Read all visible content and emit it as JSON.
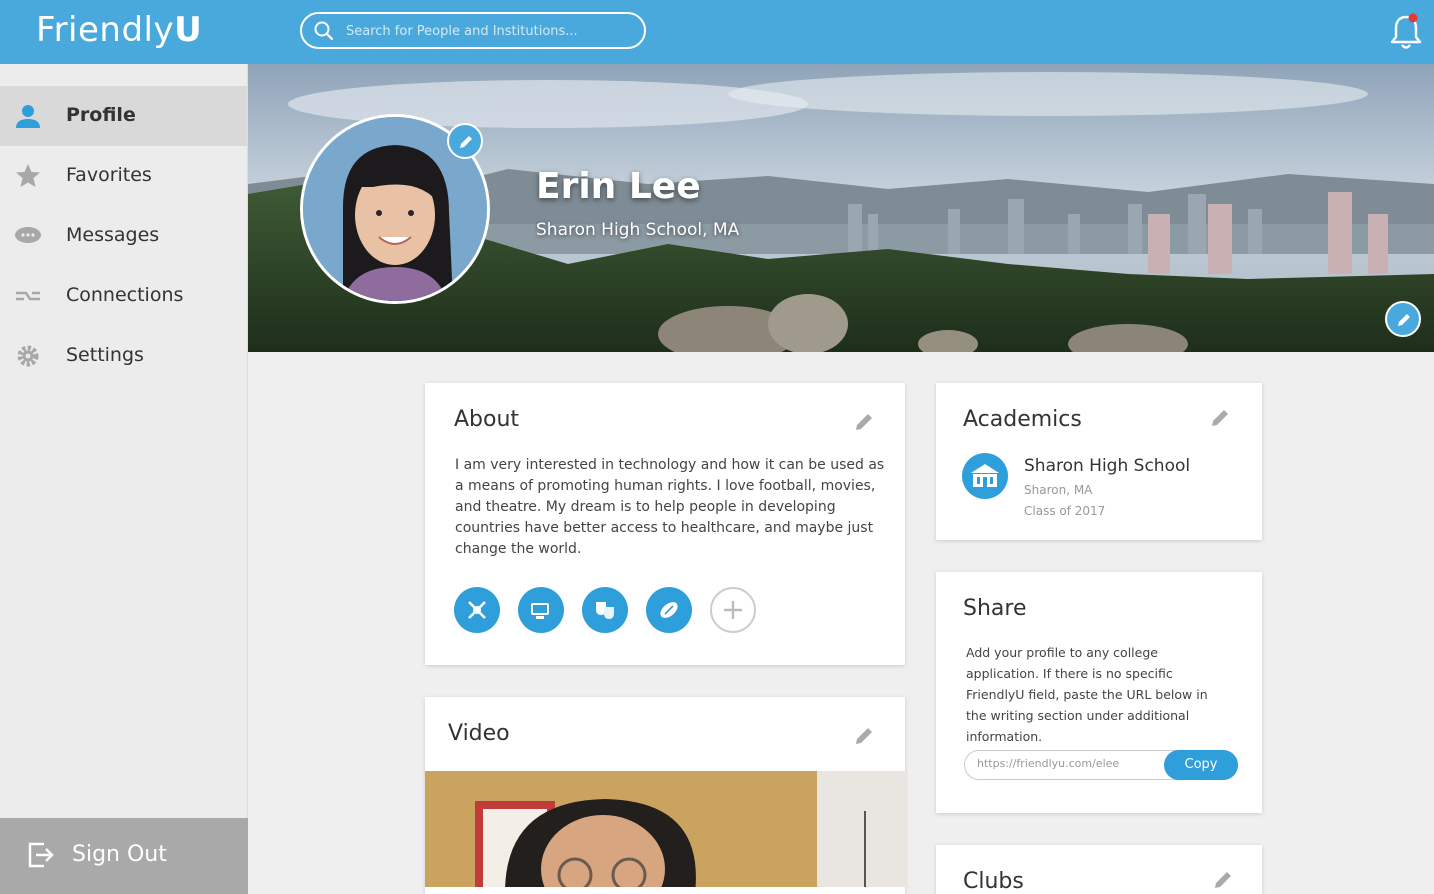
{
  "app": {
    "logo_main": "Friendly",
    "logo_bold": "U"
  },
  "search": {
    "placeholder": "Search for People and Institutions..."
  },
  "sidebar": {
    "items": [
      {
        "label": "Profile",
        "icon": "person-icon",
        "active": true
      },
      {
        "label": "Favorites",
        "icon": "star-icon"
      },
      {
        "label": "Messages",
        "icon": "chat-icon"
      },
      {
        "label": "Connections",
        "icon": "connections-icon"
      },
      {
        "label": "Settings",
        "icon": "gear-icon"
      }
    ],
    "signout_label": "Sign Out"
  },
  "profile": {
    "name": "Erin Lee",
    "school": "Sharon High School, MA"
  },
  "about": {
    "title": "About",
    "text": "I am very interested in technology and how it can be used as a means of promoting human rights. I love football, movies, and theatre. My dream is to help people in developing countries have better access to healthcare, and maybe just change the world.",
    "interests": [
      "technology-icon",
      "movies-icon",
      "theatre-icon",
      "football-icon"
    ]
  },
  "academics": {
    "title": "Academics",
    "school_name": "Sharon High School",
    "location": "Sharon, MA",
    "class": "Class of 2017"
  },
  "share": {
    "title": "Share",
    "text": "Add your profile to any college application. If there is no specific FriendlyU field, paste the URL below in the writing section under additional information.",
    "url": "https://friendlyu.com/elee",
    "copy_label": "Copy"
  },
  "video": {
    "title": "Video"
  },
  "clubs": {
    "title": "Clubs"
  },
  "colors": {
    "accent": "#4aa9dc",
    "icon_blue": "#2f9fdc",
    "notification_dot": "#e53935"
  }
}
